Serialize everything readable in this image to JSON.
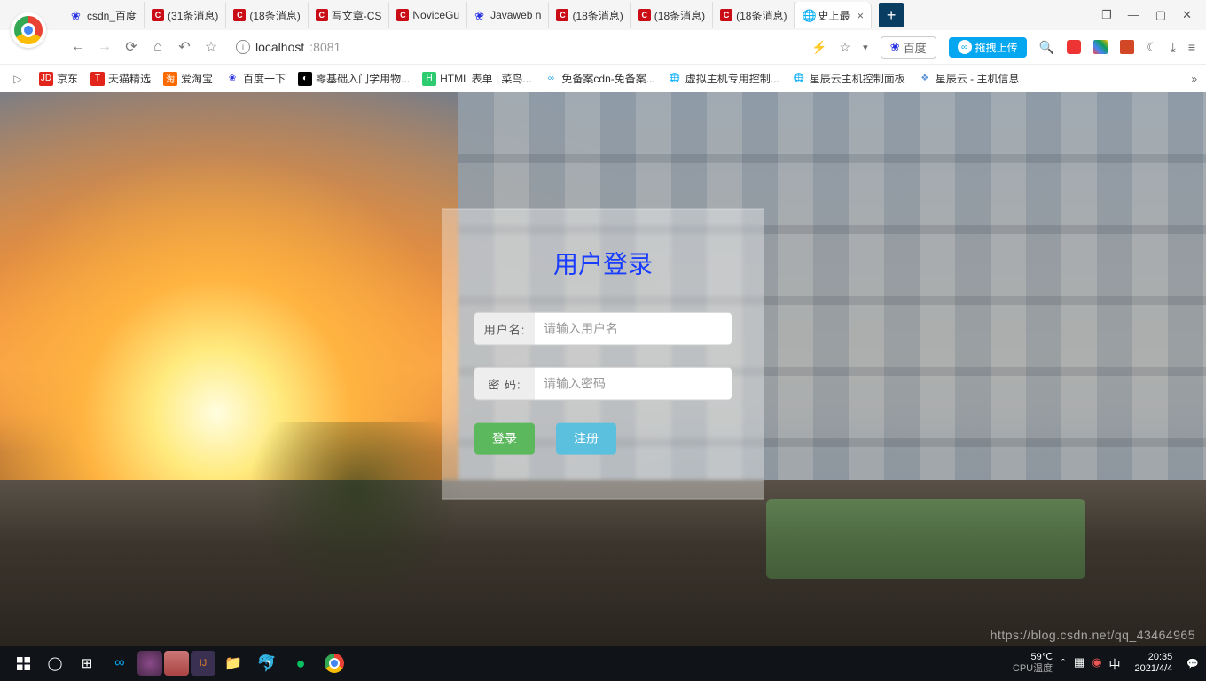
{
  "tabs": [
    {
      "favType": "baidu",
      "favText": "❀",
      "label": "csdn_百度"
    },
    {
      "favType": "csdn",
      "favText": "C",
      "label": "(31条消息)"
    },
    {
      "favType": "csdn",
      "favText": "C",
      "label": "(18条消息)"
    },
    {
      "favType": "csdn",
      "favText": "C",
      "label": "写文章-CS"
    },
    {
      "favType": "csdn",
      "favText": "C",
      "label": "NoviceGu"
    },
    {
      "favType": "baidu",
      "favText": "❀",
      "label": "Javaweb n"
    },
    {
      "favType": "csdn",
      "favText": "C",
      "label": "(18条消息)"
    },
    {
      "favType": "csdn",
      "favText": "C",
      "label": "(18条消息)"
    },
    {
      "favType": "csdn",
      "favText": "C",
      "label": "(18条消息)"
    },
    {
      "favType": "globe",
      "favText": "🌐",
      "label": "史上最",
      "active": true
    }
  ],
  "addressBar": {
    "host": "localhost",
    "port": ":8081",
    "searchEngine": "百度",
    "uploadBadge": "拖拽上传"
  },
  "bookmarks": [
    {
      "iconBg": "#e1251b",
      "iconColor": "#fff",
      "iconText": "JD",
      "label": "京东"
    },
    {
      "iconBg": "#e1251b",
      "iconColor": "#fff",
      "iconText": "T",
      "label": "天猫精选"
    },
    {
      "iconBg": "#ff6a00",
      "iconColor": "#fff",
      "iconText": "淘",
      "label": "爱淘宝"
    },
    {
      "iconBg": "",
      "iconColor": "#2932e1",
      "iconText": "❀",
      "label": "百度一下"
    },
    {
      "iconBg": "#000",
      "iconColor": "#fff",
      "iconText": "◐",
      "label": "零基础入门学用物..."
    },
    {
      "iconBg": "#2ecc71",
      "iconColor": "#fff",
      "iconText": "H",
      "label": "HTML 表单 | 菜鸟..."
    },
    {
      "iconBg": "",
      "iconColor": "#2aa5de",
      "iconText": "∞",
      "label": "免备案cdn-免备案..."
    },
    {
      "iconBg": "",
      "iconColor": "#555",
      "iconText": "🌐",
      "label": "虚拟主机专用控制..."
    },
    {
      "iconBg": "",
      "iconColor": "#555",
      "iconText": "🌐",
      "label": "星辰云主机控制面板"
    },
    {
      "iconBg": "",
      "iconColor": "#5a8fd6",
      "iconText": "❖",
      "label": "星辰云 - 主机信息"
    }
  ],
  "login": {
    "title": "用户登录",
    "usernameLabel": "用户名:",
    "usernamePlaceholder": "请输入用户名",
    "passwordLabel": "密  码:",
    "passwordPlaceholder": "请输入密码",
    "loginBtn": "登录",
    "registerBtn": "注册"
  },
  "watermark": "https://blog.csdn.net/qq_43464965",
  "taskbar": {
    "temp": "59℃",
    "tempLabel": "CPU温度",
    "time": "20:35",
    "date": "2021/4/4",
    "lang": "中"
  }
}
